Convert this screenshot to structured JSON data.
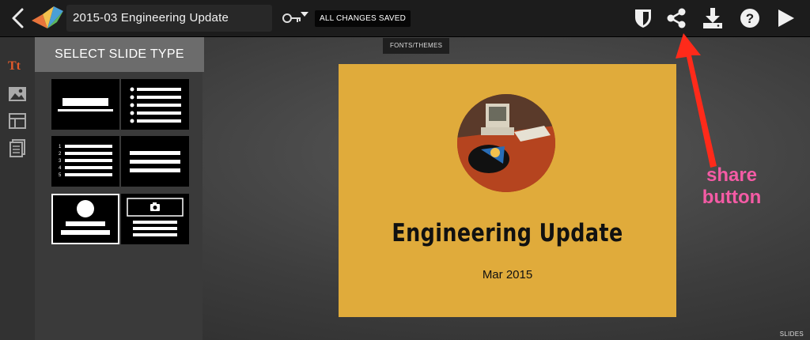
{
  "header": {
    "title": "2015-03 Engineering Update",
    "save_status": "ALL CHANGES SAVED",
    "icons": [
      "chevron-left-icon",
      "logo-icon",
      "key-icon",
      "shield-icon",
      "share-icon",
      "download-icon",
      "help-icon",
      "play-icon"
    ]
  },
  "left_rail": {
    "text_tool_label": "Tt",
    "icons": [
      "image-icon",
      "layout-icon",
      "document-icon"
    ]
  },
  "slide_type_panel": {
    "header": "SELECT SLIDE TYPE",
    "types": [
      "title",
      "bullet-list",
      "numbered-list",
      "text-lines",
      "photo-title",
      "image-caption"
    ],
    "numbered_digits": [
      "1",
      "2",
      "3",
      "4",
      "5"
    ],
    "selected": "photo-title"
  },
  "fonts_themes_label": "FONTS/THEMES",
  "slide": {
    "title": "Engineering Update",
    "date": "Mar 2015",
    "background": "#e0ab3b"
  },
  "slides_label": "SLIDES",
  "annotation": {
    "line1": "share",
    "line2": "button",
    "color": "#f45ba5",
    "arrow_color": "#ff2a1a"
  }
}
